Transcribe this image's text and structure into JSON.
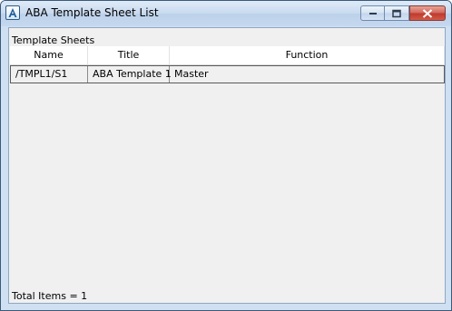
{
  "window": {
    "title": "ABA Template Sheet List"
  },
  "section": {
    "label": "Template Sheets"
  },
  "table": {
    "columns": [
      "Name",
      "Title",
      "Function"
    ],
    "rows": [
      [
        "/TMPL1/S1",
        "ABA Template 1",
        "Master"
      ]
    ]
  },
  "footer": {
    "total_text": "Total Items = 1"
  },
  "icons": {
    "app": "aba-app-icon",
    "minimize": "minimize-icon",
    "maximize": "maximize-icon",
    "close": "close-icon"
  },
  "colors": {
    "titlebar": "#c8daef",
    "close_button": "#c0382c",
    "client_background": "#f0f0f0"
  }
}
